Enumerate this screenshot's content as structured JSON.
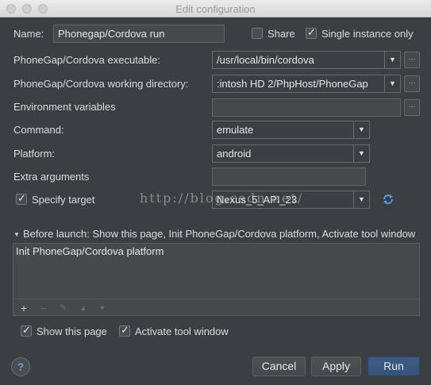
{
  "window": {
    "title": "Edit configuration"
  },
  "name_row": {
    "label": "Name:",
    "value": "Phonegap/Cordova run",
    "share_label": "Share",
    "share_checked": false,
    "single_instance_label": "Single instance only",
    "single_instance_checked": true
  },
  "fields": {
    "executable": {
      "label": "PhoneGap/Cordova executable:",
      "value": "/usr/local/bin/cordova"
    },
    "working_dir": {
      "label": "PhoneGap/Cordova working directory:",
      "value": ":intosh HD 2/PhpHost/PhoneGap"
    },
    "env_vars": {
      "label": "Environment variables",
      "value": ""
    },
    "command": {
      "label": "Command:",
      "value": "emulate"
    },
    "platform": {
      "label": "Platform:",
      "value": "android"
    },
    "extra_args": {
      "label": "Extra arguments",
      "value": ""
    },
    "target": {
      "label": "Specify target",
      "checked": true,
      "value": "Nexus_5_API_23"
    }
  },
  "watermark": "http://blog.csdn.net/",
  "before_launch": {
    "header": "Before launch: Show this page, Init PhoneGap/Cordova platform, Activate tool window",
    "items": [
      "Init PhoneGap/Cordova platform"
    ]
  },
  "toolbar": {
    "add": "+",
    "remove": "−",
    "edit": "✎",
    "up": "▲",
    "down": "▼"
  },
  "options": {
    "show_page_label": "Show this page",
    "show_page_checked": true,
    "activate_tool_label": "Activate tool window",
    "activate_tool_checked": true
  },
  "buttons": {
    "help": "?",
    "cancel": "Cancel",
    "apply": "Apply",
    "run": "Run"
  },
  "colors": {
    "background": "#3c3f41",
    "default_button": "#365277",
    "refresh_icon": "#4a9ee8"
  }
}
